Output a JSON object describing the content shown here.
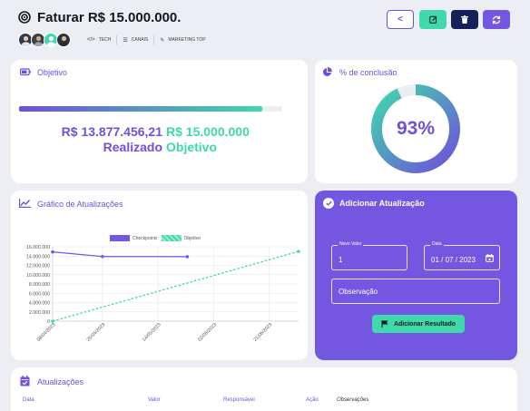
{
  "header": {
    "title": "Faturar R$ 15.000.000.",
    "tags": [
      {
        "icon": "code-icon",
        "glyph": "</>",
        "label": "TECH"
      },
      {
        "icon": "list-icon",
        "glyph": "☰",
        "label": "CANAIS"
      },
      {
        "icon": "magic-wand-icon",
        "glyph": "✎",
        "label": "MARKETING TOP"
      }
    ],
    "buttons": {
      "back": "<"
    }
  },
  "objective": {
    "title": "Objetivo",
    "progress_fraction": 0.925,
    "realizado_value": "R$ 13.877.456,21",
    "objetivo_value": "R$ 15.000.000",
    "realizado_label": "Realizado",
    "objetivo_label": "Objetivo"
  },
  "completion": {
    "title": "% de conclusão",
    "percent_text": "93%",
    "percent": 93
  },
  "updates_chart": {
    "title": "Gráfico de Atualizações"
  },
  "chart_data": {
    "type": "line",
    "title": "",
    "ylim": [
      0,
      16000000
    ],
    "y_ticks": [
      "16.000.000",
      "14.000.000",
      "12.000.000",
      "10.000.000",
      "8.000.000",
      "6.000.000",
      "4.000.000",
      "2.000.000",
      "0"
    ],
    "x_ticks": [
      "08/04/2023",
      "25/04/2023",
      "14/05/2023",
      "02/06/2023",
      "21/06/2023"
    ],
    "x_range": [
      "2023-04-08",
      "2023-07-01"
    ],
    "legend": [
      "Checkpoints",
      "Objetivo"
    ],
    "series": [
      {
        "name": "Checkpoints",
        "color": "#7357e0",
        "points": [
          [
            "2023-04-08",
            14900000
          ],
          [
            "2023-04-25",
            13900000
          ],
          [
            "2023-05-24",
            13877456
          ]
        ]
      },
      {
        "name": "Objetivo",
        "color": "#3fd9ab",
        "dashed": true,
        "points": [
          [
            "2023-04-08",
            0
          ],
          [
            "2023-07-01",
            15000000
          ]
        ]
      }
    ]
  },
  "add_update": {
    "title": "Adicionar Atualização",
    "novo_valor_label": "Novo Valor",
    "novo_valor_value": "1",
    "data_label": "Data",
    "data_value": "01 / 07 / 2023",
    "observacao_placeholder": "Observação",
    "submit_label": "Adicionar Resultado"
  },
  "updates_table": {
    "title": "Atualizações",
    "columns": [
      "Data",
      "Valor",
      "Responsável",
      "Ação",
      "Observações"
    ]
  },
  "colors": {
    "primary": "#7357e0",
    "accent": "#3fd9ab",
    "dark": "#16205a"
  }
}
